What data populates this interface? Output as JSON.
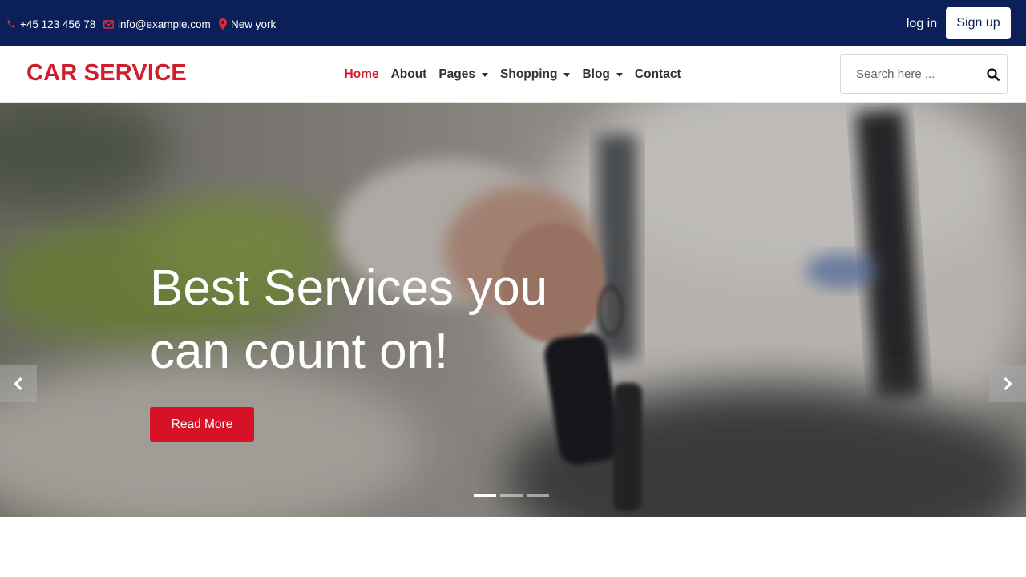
{
  "topbar": {
    "phone": "+45 123 456 78",
    "email": "info@example.com",
    "location": "New york",
    "login_label": "log in",
    "signup_label": "Sign up"
  },
  "navbar": {
    "brand": "CAR SERVICE",
    "items": [
      {
        "label": "Home",
        "active": true,
        "dropdown": false
      },
      {
        "label": "About",
        "active": false,
        "dropdown": false
      },
      {
        "label": "Pages",
        "active": false,
        "dropdown": true
      },
      {
        "label": "Shopping",
        "active": false,
        "dropdown": true
      },
      {
        "label": "Blog",
        "active": false,
        "dropdown": true
      },
      {
        "label": "Contact",
        "active": false,
        "dropdown": false
      }
    ],
    "search_placeholder": "Search here ..."
  },
  "hero": {
    "title_line1": "Best Services you",
    "title_line2": "can count on!",
    "cta_label": "Read More",
    "slides_count": 3,
    "active_slide": 1
  },
  "icons": {
    "phone": "phone-icon",
    "email": "envelope-icon",
    "location": "map-marker-icon",
    "search": "search-icon",
    "prev": "chevron-left-icon",
    "next": "chevron-right-icon"
  },
  "colors": {
    "topbar_bg": "#0b1f58",
    "brand_red": "#d01d2c",
    "cta_red": "#d81226",
    "nav_text": "#333333"
  }
}
